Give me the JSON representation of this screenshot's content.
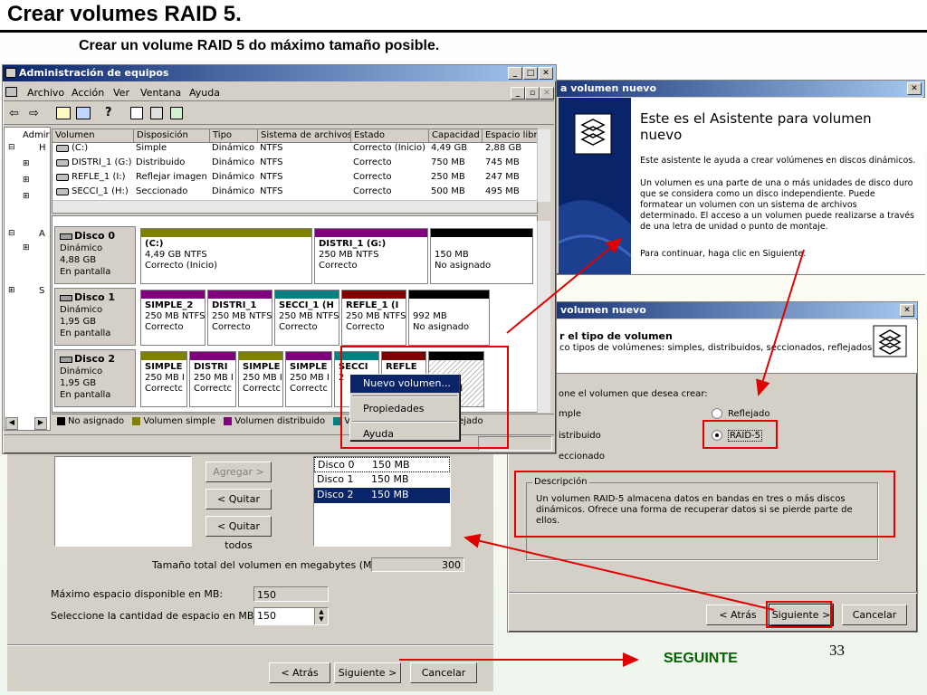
{
  "slide": {
    "title": "Crear volumes RAID 5.",
    "subtitle": "Crear un volume RAID 5 do máximo tamaño posible.",
    "page_number": "33",
    "next_label": "SEGUINTE"
  },
  "colors": {
    "unallocated": "#000000",
    "simple": "#808000",
    "spanned": "#800080",
    "striped": "#008080",
    "mirrored": "#800000",
    "raid5": "#00a0a0",
    "arrow": "#e00000"
  },
  "computer_management": {
    "title": "Administración de equipos",
    "menu": [
      "Archivo",
      "Acción",
      "Ver",
      "Ventana",
      "Ayuda"
    ],
    "tree_partial": [
      "Admir",
      "H",
      "A",
      "S"
    ],
    "columns": [
      "Volumen",
      "Disposición",
      "Tipo",
      "Sistema de archivos",
      "Estado",
      "Capacidad",
      "Espacio libre"
    ],
    "rows": [
      [
        "(C:)",
        "Simple",
        "Dinámico",
        "NTFS",
        "Correcto (Inicio)",
        "4,49 GB",
        "2,88 GB"
      ],
      [
        "DISTRI_1 (G:)",
        "Distribuido",
        "Dinámico",
        "NTFS",
        "Correcto",
        "750 MB",
        "745 MB"
      ],
      [
        "REFLE_1 (I:)",
        "Reflejar imagen",
        "Dinámico",
        "NTFS",
        "Correcto",
        "250 MB",
        "247 MB"
      ],
      [
        "SECCI_1 (H:)",
        "Seccionado",
        "Dinámico",
        "NTFS",
        "Correcto",
        "500 MB",
        "495 MB"
      ]
    ],
    "disks": [
      {
        "name": "Disco 0",
        "type": "Dinámico",
        "size": "4,88 GB",
        "status": "En pantalla",
        "partitions": [
          {
            "name": "(C:)",
            "size": "4,49 GB NTFS",
            "state": "Correcto (Inicio)",
            "color": "#808000"
          },
          {
            "name": "DISTRI_1 (G:)",
            "size": "250 MB NTFS",
            "state": "Correcto",
            "color": "#800080"
          },
          {
            "name": "",
            "size": "150 MB",
            "state": "No asignado",
            "color": "#000000"
          }
        ]
      },
      {
        "name": "Disco 1",
        "type": "Dinámico",
        "size": "1,95 GB",
        "status": "En pantalla",
        "partitions": [
          {
            "name": "SIMPLE_2",
            "size": "250 MB NTFS",
            "state": "Correcto",
            "color": "#800080"
          },
          {
            "name": "DISTRI_1",
            "size": "250 MB NTFS",
            "state": "Correcto",
            "color": "#800080"
          },
          {
            "name": "SECCI_1 (H",
            "size": "250 MB NTFS",
            "state": "Correcto",
            "color": "#008080"
          },
          {
            "name": "REFLE_1 (I",
            "size": "250 MB NTFS",
            "state": "Correcto",
            "color": "#800000"
          },
          {
            "name": "",
            "size": "992 MB",
            "state": "No asignado",
            "color": "#000000"
          }
        ]
      },
      {
        "name": "Disco 2",
        "type": "Dinámico",
        "size": "1,95 GB",
        "status": "En pantalla",
        "partitions": [
          {
            "name": "SIMPLE",
            "size": "250 MB I",
            "state": "Correctc",
            "color": "#808000"
          },
          {
            "name": "DISTRI",
            "size": "250 MB I",
            "state": "Correctc",
            "color": "#800080"
          },
          {
            "name": "SIMPLE",
            "size": "250 MB I",
            "state": "Correctc",
            "color": "#808000"
          },
          {
            "name": "SIMPLE",
            "size": "250 MB I",
            "state": "Correctc",
            "color": "#800080"
          },
          {
            "name": "SECCI",
            "size": "2",
            "state": "",
            "color": "#008080"
          },
          {
            "name": "REFLE",
            "size": "",
            "state": "",
            "color": "#800000"
          },
          {
            "name": "",
            "size": "MB",
            "state": "signad",
            "color": "#000000"
          }
        ]
      }
    ],
    "context_menu": [
      "Nuevo volumen...",
      "Propiedades",
      "Ayuda"
    ],
    "legend": [
      "No asignado",
      "Volumen simple",
      "Volumen distribuido",
      "Volu",
      "reflejado"
    ]
  },
  "wizard_welcome": {
    "title": "a volumen nuevo",
    "heading": "Este es el Asistente para volumen nuevo",
    "p1": "Este asistente le ayuda a crear volúmenes en discos dinámicos.",
    "p2": "Un volumen es una parte de una o más unidades de disco duro que se considera como un disco independiente. Puede formatear un volumen con un sistema de archivos determinado. El acceso a un volumen puede realizarse a través de una letra de unidad o punto de montaje.",
    "p3": "Para continuar, haga clic en Siguiente."
  },
  "wizard_type": {
    "title": "volumen nuevo",
    "header_title": "r el tipo de volumen",
    "header_sub": "co tipos de volúmenes: simples, distribuidos, seccionados, reflejados, y",
    "prompt": "one el volumen que desea crear:",
    "options": [
      "mple",
      "Reflejado",
      "istribuido",
      "RAID-5",
      "eccionado"
    ],
    "description_legend": "Descripción",
    "description": "Un volumen RAID-5 almacena datos en bandas en tres o más discos dinámicos. Ofrece una forma de recuperar datos si se pierde parte de ellos.",
    "buttons": {
      "back": "< Atrás",
      "next": "Siguiente >",
      "cancel": "Cancelar"
    }
  },
  "wizard_disks": {
    "add": "Agregar >",
    "remove": "< Quitar",
    "remove_all": "< Quitar todos",
    "selected": [
      [
        "Disco 0",
        "150 MB"
      ],
      [
        "Disco 1",
        "150 MB"
      ],
      [
        "Disco 2",
        "150 MB"
      ]
    ],
    "total_label": "Tamaño total del volumen en megabytes (MB):",
    "total_value": "300",
    "max_label": "Máximo espacio disponible en MB:",
    "max_value": "150",
    "amount_label": "Seleccione la cantidad de espacio en MB:",
    "amount_value": "150",
    "buttons": {
      "back": "< Atrás",
      "next": "Siguiente >",
      "cancel": "Cancelar"
    }
  }
}
